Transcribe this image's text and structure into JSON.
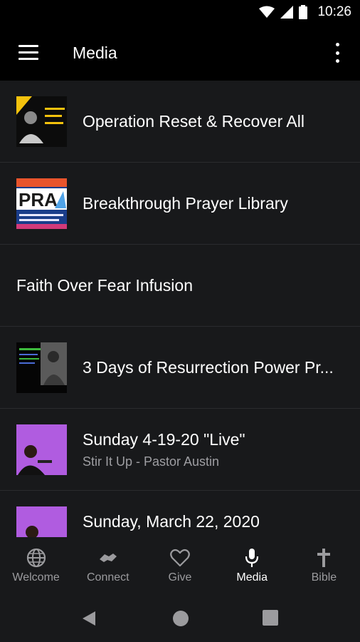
{
  "status": {
    "time": "10:26"
  },
  "app_bar": {
    "title": "Media"
  },
  "items": [
    {
      "title": "Operation Reset & Recover All"
    },
    {
      "title": "Breakthrough Prayer Library",
      "thumb_text": "PRA"
    },
    {
      "title": "Faith Over Fear Infusion"
    },
    {
      "title": "3 Days of Resurrection Power Pr..."
    },
    {
      "title": "Sunday 4-19-20 \"Live\"",
      "subtitle": "Stir It Up - Pastor Austin"
    },
    {
      "title": "Sunday, March 22, 2020"
    }
  ],
  "nav": [
    {
      "label": "Welcome",
      "icon": "globe-icon"
    },
    {
      "label": "Connect",
      "icon": "handshake-icon"
    },
    {
      "label": "Give",
      "icon": "heart-icon"
    },
    {
      "label": "Media",
      "icon": "microphone-icon",
      "active": true
    },
    {
      "label": "Bible",
      "icon": "cross-icon"
    }
  ],
  "colors": {
    "active": "#ffffff",
    "inactive": "#9b9b9e",
    "thumb_purple": "#b05ce0",
    "thumb_yellow": "#f4c20d"
  }
}
